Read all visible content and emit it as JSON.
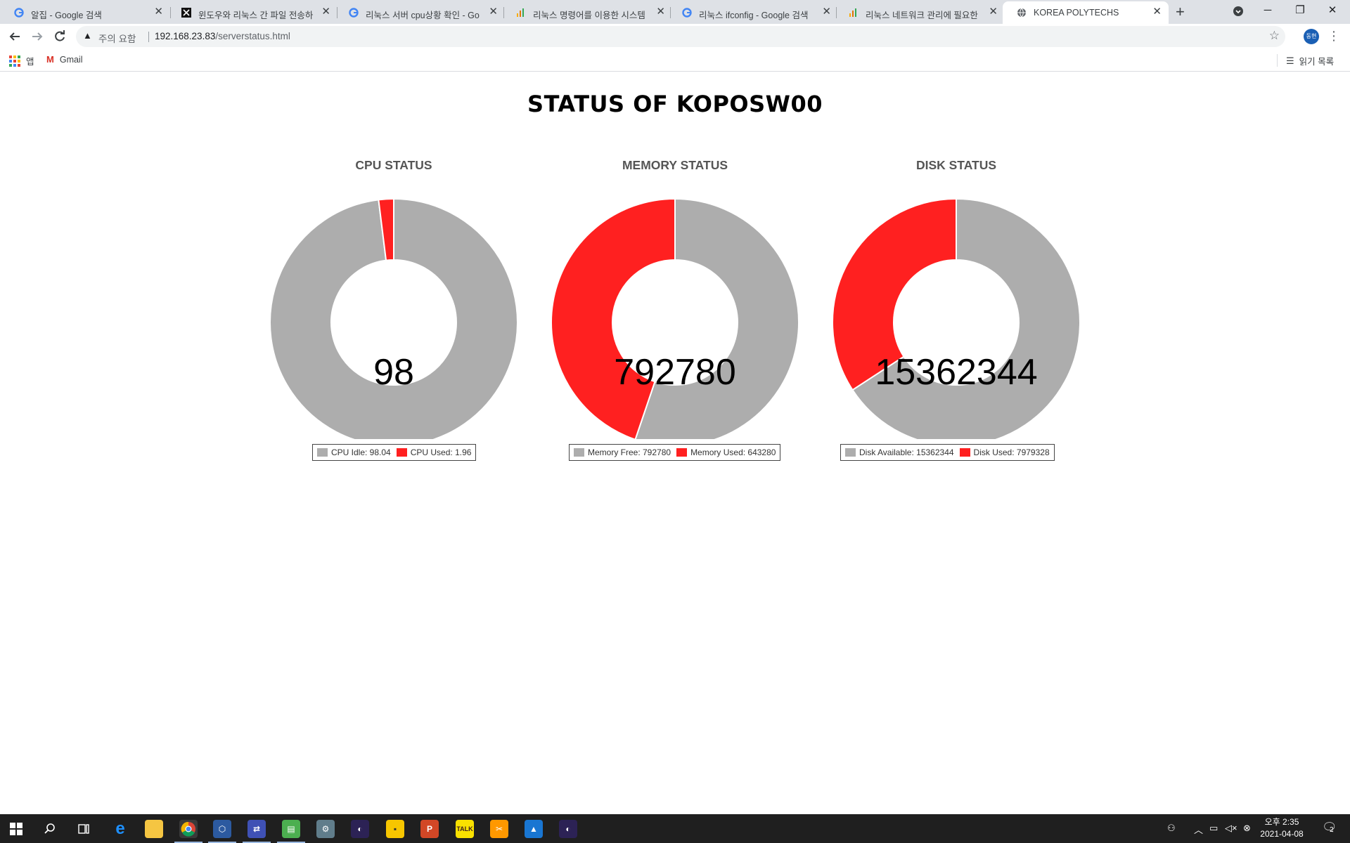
{
  "browser": {
    "tabs": [
      {
        "label": "알집 - Google 검색",
        "favicon": "google-g-icon",
        "active": false
      },
      {
        "label": "윈도우와 리눅스 간 파일 전송하",
        "favicon": "x-logo-icon",
        "active": false
      },
      {
        "label": "리눅스 서버 cpu상황 확인 - Go",
        "favicon": "google-g-icon",
        "active": false
      },
      {
        "label": "리눅스 명령어를 이용한 시스템",
        "favicon": "bar-chart-icon",
        "active": false
      },
      {
        "label": "리눅스 ifconfig - Google 검색",
        "favicon": "google-g-icon",
        "active": false
      },
      {
        "label": "리눅스 네트워크 관리에 필요한",
        "favicon": "bar-chart-icon",
        "active": false
      },
      {
        "label": "KOREA POLYTECHS",
        "favicon": "globe-icon",
        "active": true
      }
    ],
    "omnibox": {
      "security_label": "주의 요함",
      "url_host": "192.168.23.83",
      "url_path": "/serverstatus.html"
    },
    "profile_initials": "동현",
    "bookmarks": {
      "apps_label": "앱",
      "gmail_label": "Gmail",
      "reading_list_label": "읽기 목록"
    }
  },
  "page": {
    "title": "STATUS OF KOPOSW00"
  },
  "chart_data": [
    {
      "type": "pie",
      "title": "CPU STATUS",
      "center_label": "98",
      "labels": [
        "CPU Idle",
        "CPU Used"
      ],
      "legend_text": [
        "CPU Idle: 98.04",
        "CPU Used: 1.96"
      ],
      "values": [
        98.04,
        1.96
      ],
      "colors": [
        "#adadad",
        "#ff2020"
      ]
    },
    {
      "type": "pie",
      "title": "MEMORY STATUS",
      "center_label": "792780",
      "labels": [
        "Memory Free",
        "Memory Used"
      ],
      "legend_text": [
        "Memory Free: 792780",
        "Memory Used: 643280"
      ],
      "values": [
        792780,
        643280
      ],
      "colors": [
        "#adadad",
        "#ff2020"
      ]
    },
    {
      "type": "pie",
      "title": "DISK STATUS",
      "center_label": "15362344",
      "labels": [
        "Disk Available",
        "Disk Used"
      ],
      "legend_text": [
        "Disk Available: 15362344",
        "Disk Used: 7979328"
      ],
      "values": [
        15362344,
        7979328
      ],
      "colors": [
        "#adadad",
        "#ff2020"
      ]
    }
  ],
  "taskbar": {
    "apps": [
      "start-icon",
      "search-icon",
      "task-view-icon",
      "edge-icon",
      "file-explorer-icon",
      "chrome-icon",
      "virtualbox-icon",
      "network-tool-icon",
      "notepad-icon",
      "putty-icon",
      "eclipse-icon",
      "sticky-notes-icon",
      "powerpoint-icon",
      "kakaotalk-icon",
      "tools-icon",
      "photos-icon",
      "eclipse-icon-2"
    ],
    "kakao_label": "TALK",
    "ppt_label": "P",
    "clock_time": "오후 2:35",
    "clock_date": "2021-04-08",
    "notification_count": "2"
  }
}
